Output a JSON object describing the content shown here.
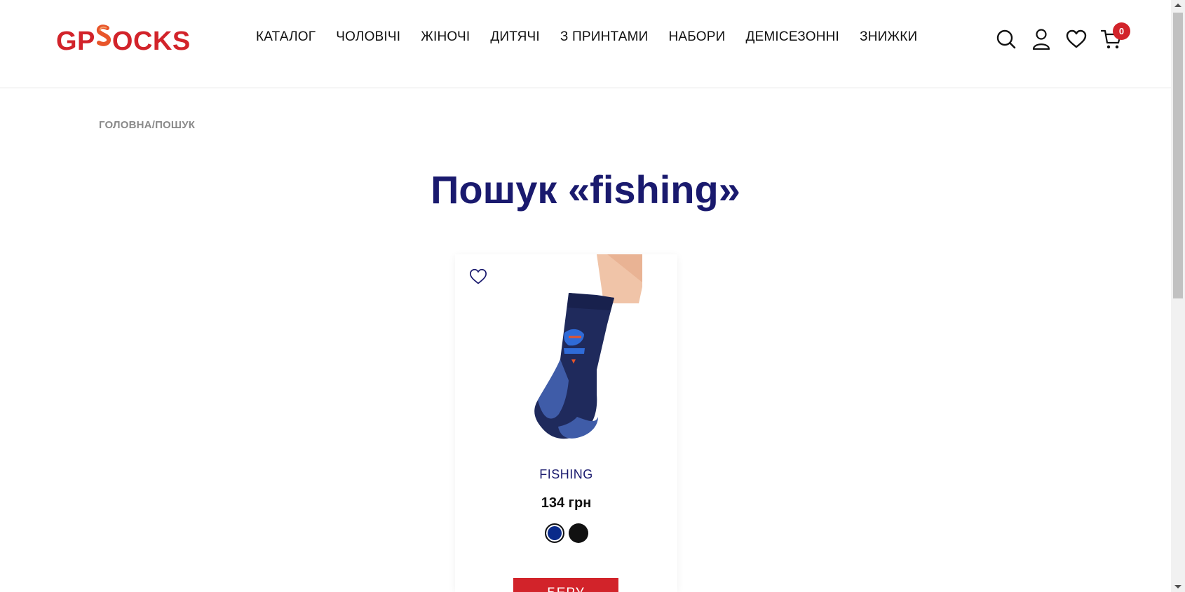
{
  "brand": {
    "logo_prefix": "GP",
    "logo_s": "S",
    "logo_suffix": "OCKS",
    "color": "#d2232a"
  },
  "nav": {
    "items": [
      "КАТАЛОГ",
      "ЧОЛОВІЧІ",
      "ЖІНОЧІ",
      "ДИТЯЧІ",
      "З ПРИНТАМИ",
      "НАБОРИ",
      "ДЕМІСЕЗОННІ",
      "ЗНИЖКИ"
    ]
  },
  "header_icons": {
    "search": "search-icon",
    "account": "user-icon",
    "wishlist": "heart-icon",
    "cart": "cart-icon",
    "cart_count": "0"
  },
  "breadcrumb": {
    "home": "ГОЛОВНА",
    "separator": "/",
    "current": "ПОШУК"
  },
  "page": {
    "title": "Пошук «fishing»"
  },
  "product": {
    "name": "FISHING",
    "price": "134 грн",
    "colors": [
      "#0a2a8a",
      "#111111"
    ],
    "selected_color": 0,
    "buy_label": "БЕРУ",
    "wishlist_icon": "heart-outline-icon"
  },
  "colors": {
    "accent": "#d2232a",
    "title": "#1a1a6e"
  }
}
